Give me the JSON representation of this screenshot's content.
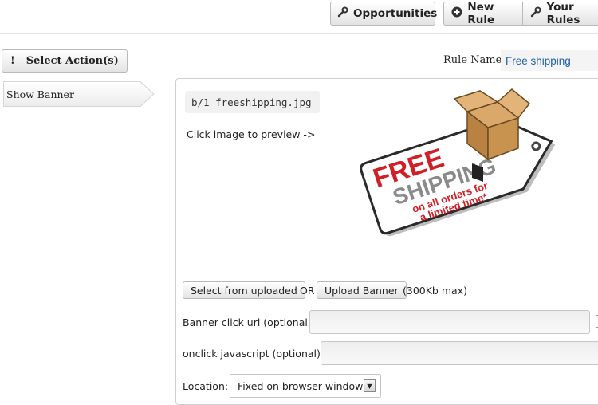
{
  "toolbar": {
    "opportunities_label": "Opportunities",
    "new_rule_label": "New Rule",
    "your_rules_label": "Your Rules"
  },
  "actions": {
    "select_label": "Select Action(s)",
    "select_icon": "!",
    "items": [
      {
        "label": "Show Banner"
      }
    ]
  },
  "rule": {
    "name_label": "Rule Name:",
    "name_value": "Free shipping"
  },
  "banner": {
    "filename": "b/1_freeshipping.jpg",
    "preview_hint": "Click image to preview ->",
    "image": {
      "line1": "FREE",
      "line2": "SHIPPING",
      "line3": "on all orders for",
      "line4": "a limited time*",
      "accent_color": "#d01f26",
      "text_gray": "#8a8a8a"
    },
    "select_uploaded_label": "Select from uploaded",
    "or_label": "OR",
    "upload_label": "Upload Banner",
    "size_note": "(300Kb max)",
    "click_url_label": "Banner click url (optional):",
    "click_url_value": "",
    "onclick_label": "onclick javascript (optional):",
    "onclick_value": "",
    "location_label": "Location:",
    "location_value": "Fixed on browser window"
  }
}
